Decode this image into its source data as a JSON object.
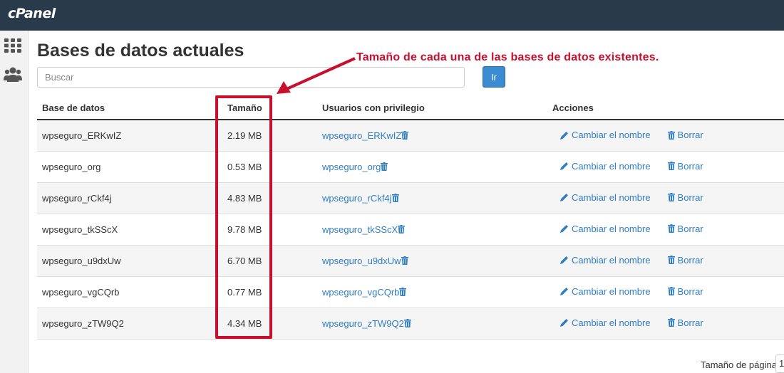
{
  "app": {
    "logo": "cPanel"
  },
  "page": {
    "title": "Bases de datos actuales"
  },
  "search": {
    "placeholder": "Buscar",
    "go_label": "Ir"
  },
  "annotation": {
    "text": "Tamaño de cada una de las bases de datos existentes.",
    "color": "#c8102e"
  },
  "table": {
    "headers": {
      "db": "Base de datos",
      "size": "Tamaño",
      "users": "Usuarios con privilegio",
      "actions": "Acciones"
    },
    "rename_label": "Cambiar el nombre",
    "delete_label": "Borrar",
    "rows": [
      {
        "db": "wpseguro_ERKwIZ",
        "size": "2.19 MB",
        "user": "wpseguro_ERKwIZ"
      },
      {
        "db": "wpseguro_org",
        "size": "0.53 MB",
        "user": "wpseguro_org"
      },
      {
        "db": "wpseguro_rCkf4j",
        "size": "4.83 MB",
        "user": "wpseguro_rCkf4j"
      },
      {
        "db": "wpseguro_tkSScX",
        "size": "9.78 MB",
        "user": "wpseguro_tkSScX"
      },
      {
        "db": "wpseguro_u9dxUw",
        "size": "6.70 MB",
        "user": "wpseguro_u9dxUw"
      },
      {
        "db": "wpseguro_vgCQrb",
        "size": "0.77 MB",
        "user": "wpseguro_vgCQrb"
      },
      {
        "db": "wpseguro_zTW9Q2",
        "size": "4.34 MB",
        "user": "wpseguro_zTW9Q2"
      }
    ]
  },
  "pager": {
    "page_size_label": "Tamaño de página",
    "page_size_value": "1"
  },
  "colors": {
    "topbar": "#293a4a",
    "link": "#2f7ec4",
    "button": "#3b8bd2",
    "highlight": "#c8102e"
  },
  "icons": {
    "apps": "grid-icon",
    "users": "users-icon",
    "trash": "trash-icon",
    "pencil": "pencil-icon"
  }
}
